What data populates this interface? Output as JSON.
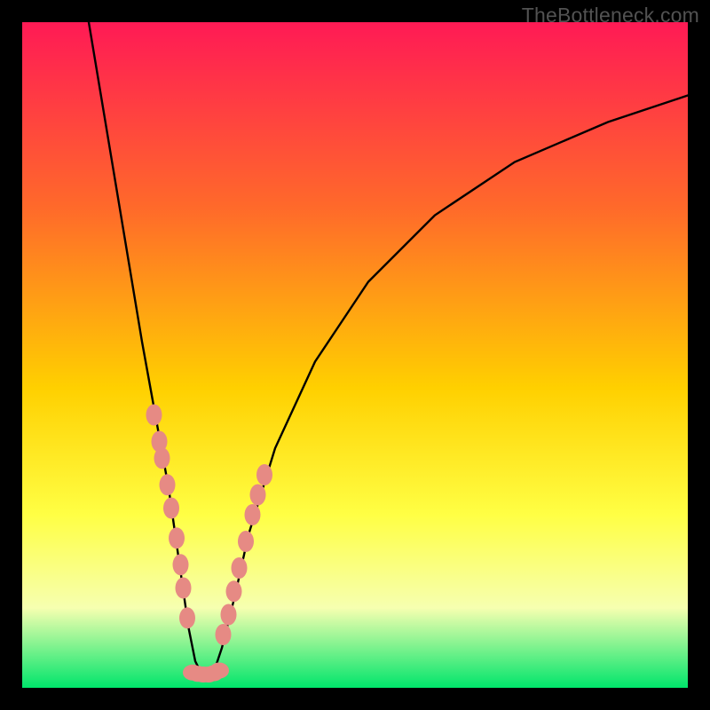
{
  "watermark": "TheBottleneck.com",
  "colors": {
    "frame": "#000000",
    "gradient_top": "#ff1a55",
    "gradient_mid1": "#ff6a2a",
    "gradient_mid2": "#ffd000",
    "gradient_mid3": "#ffff44",
    "gradient_mid4": "#f6ffb0",
    "gradient_bottom": "#00e56b",
    "curve": "#000000",
    "marker_fill": "#e68a84",
    "marker_stroke": "#e68a84"
  },
  "chart_data": {
    "type": "line",
    "title": "",
    "xlabel": "",
    "ylabel": "",
    "xlim": [
      0,
      100
    ],
    "ylim": [
      0,
      100
    ],
    "grid": false,
    "legend": false,
    "note": "V-shaped bottleneck curve; minimum ≈ (27, 2). Values are % estimates read from pixel positions (no explicit axis ticks are rendered).",
    "series": [
      {
        "name": "bottleneck-curve",
        "x": [
          10,
          12,
          14,
          16,
          18,
          20,
          22,
          24,
          25,
          26,
          27,
          28,
          29,
          30,
          32,
          34,
          38,
          44,
          52,
          62,
          74,
          88,
          100
        ],
        "y": [
          100,
          88,
          76,
          64,
          52,
          41,
          30,
          16,
          9,
          4,
          2,
          2,
          3,
          6,
          14,
          23,
          36,
          49,
          61,
          71,
          79,
          85,
          89
        ]
      }
    ],
    "markers_left": [
      {
        "x": 19.8,
        "y": 41.0
      },
      {
        "x": 20.6,
        "y": 37.0
      },
      {
        "x": 21.0,
        "y": 34.5
      },
      {
        "x": 21.8,
        "y": 30.5
      },
      {
        "x": 22.4,
        "y": 27.0
      },
      {
        "x": 23.2,
        "y": 22.5
      },
      {
        "x": 23.8,
        "y": 18.5
      },
      {
        "x": 24.2,
        "y": 15.0
      },
      {
        "x": 24.8,
        "y": 10.5
      }
    ],
    "markers_right": [
      {
        "x": 30.2,
        "y": 8.0
      },
      {
        "x": 31.0,
        "y": 11.0
      },
      {
        "x": 31.8,
        "y": 14.5
      },
      {
        "x": 32.6,
        "y": 18.0
      },
      {
        "x": 33.6,
        "y": 22.0
      },
      {
        "x": 34.6,
        "y": 26.0
      },
      {
        "x": 35.4,
        "y": 29.0
      },
      {
        "x": 36.4,
        "y": 32.0
      }
    ],
    "markers_bottom": [
      {
        "x": 25.6,
        "y": 2.3
      },
      {
        "x": 26.4,
        "y": 2.1
      },
      {
        "x": 27.2,
        "y": 2.0
      },
      {
        "x": 28.0,
        "y": 2.0
      },
      {
        "x": 28.8,
        "y": 2.2
      },
      {
        "x": 29.6,
        "y": 2.6
      }
    ]
  }
}
